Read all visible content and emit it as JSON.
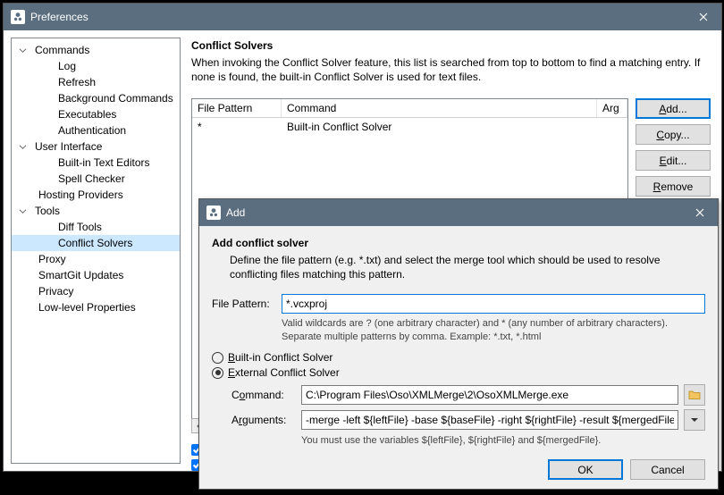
{
  "prefs_window": {
    "title": "Preferences",
    "tree": {
      "commands": "Commands",
      "log": "Log",
      "refresh": "Refresh",
      "bg": "Background Commands",
      "exec": "Executables",
      "auth": "Authentication",
      "ui": "User Interface",
      "editors": "Built-in Text Editors",
      "spell": "Spell Checker",
      "hosting": "Hosting Providers",
      "tools": "Tools",
      "diff": "Diff Tools",
      "solvers": "Conflict Solvers",
      "proxy": "Proxy",
      "updates": "SmartGit Updates",
      "privacy": "Privacy",
      "lowlevel": "Low-level Properties"
    },
    "content": {
      "heading": "Conflict Solvers",
      "description": "When invoking the Conflict Solver feature, this list is searched from top to bottom to find a matching entry. If none is found, the built-in Conflict Solver is used for text files.",
      "table": {
        "col_pattern": "File Pattern",
        "col_command": "Command",
        "col_args": "Arg",
        "row0_pattern": "*",
        "row0_command": "Built-in Conflict Solver"
      },
      "buttons": {
        "add": "Add...",
        "copy": "Copy...",
        "edit": "Edit...",
        "remove": "Remove"
      }
    }
  },
  "add_dialog": {
    "title": "Add",
    "heading": "Add conflict solver",
    "description": "Define the file pattern (e.g. *.txt) and select the merge tool which should be used to resolve conflicting files matching this pattern.",
    "file_pattern_label": "File Pattern:",
    "file_pattern_value": "*.vcxproj",
    "file_pattern_hint": "Valid wildcards are ? (one arbitrary character) and * (any number of arbitrary characters). Separate multiple patterns by comma. Example: *.txt, *.html",
    "radio_builtin": "Built-in Conflict Solver",
    "radio_external": "External Conflict Solver",
    "command_label": "Command:",
    "command_value": "C:\\Program Files\\Oso\\XMLMerge\\2\\OsoXMLMerge.exe",
    "arguments_label": "Arguments:",
    "arguments_value": "-merge -left ${leftFile} -base ${baseFile} -right ${rightFile} -result ${mergedFile}",
    "arguments_hint": "You must use the variables ${leftFile}, ${rightFile} and ${mergedFile}.",
    "ok": "OK",
    "cancel": "Cancel"
  }
}
